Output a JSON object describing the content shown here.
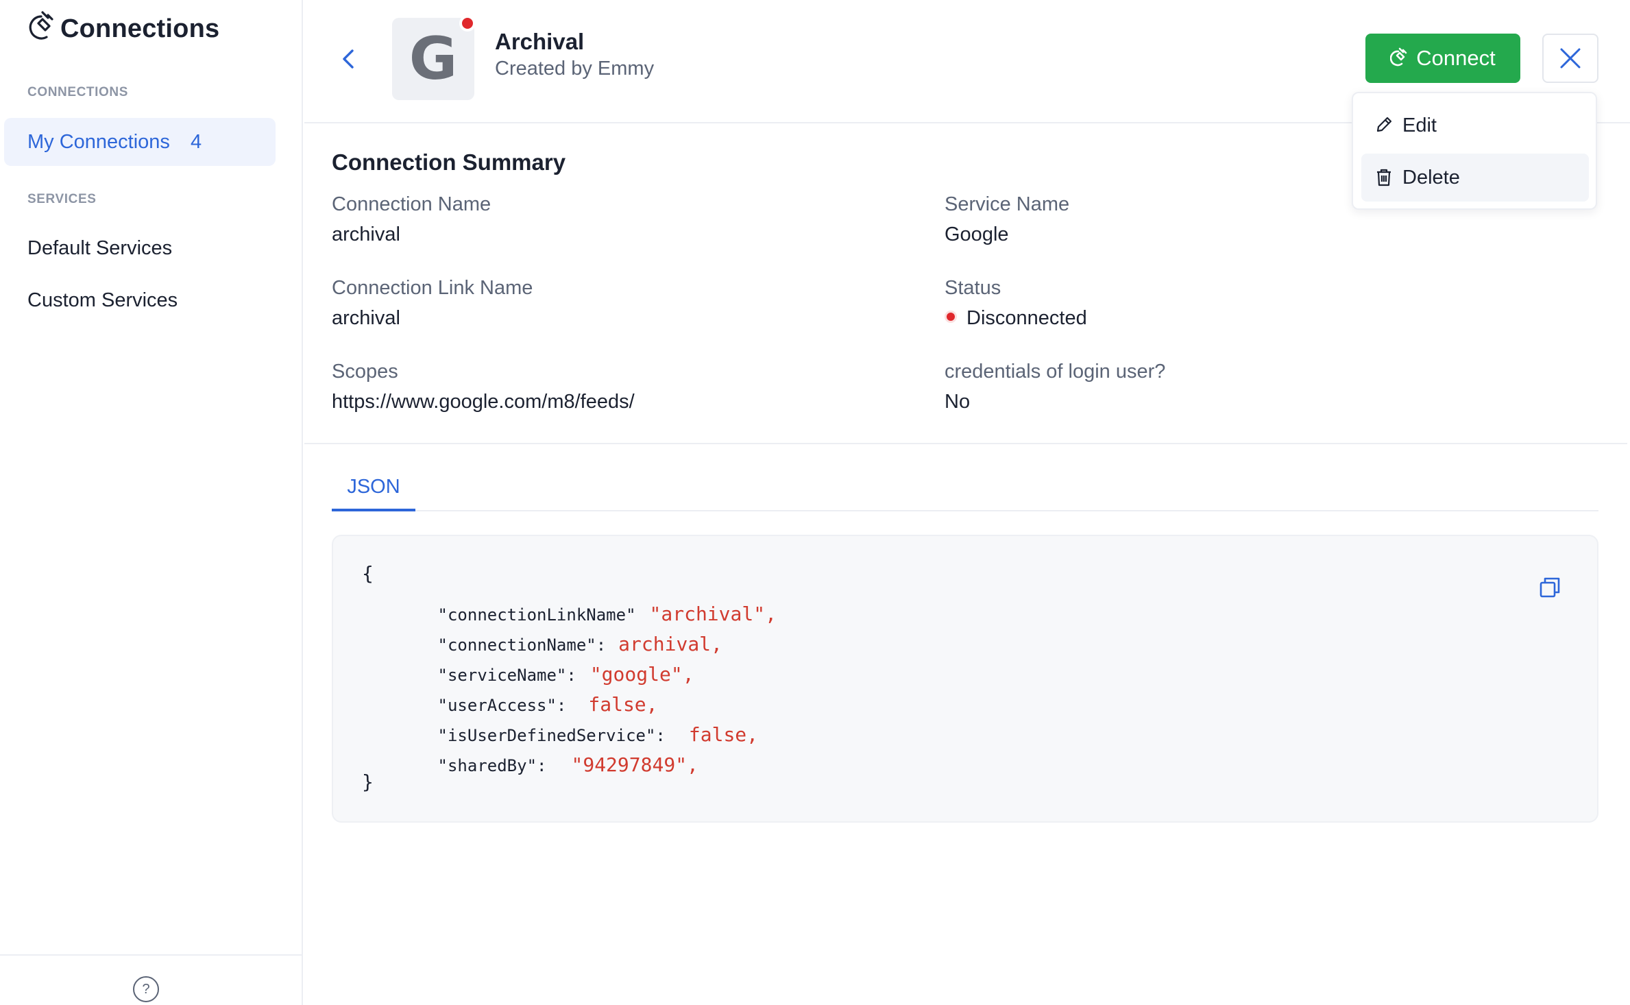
{
  "sidebar": {
    "title": "Connections",
    "section_connections": "CONNECTIONS",
    "my_connections_label": "My Connections",
    "my_connections_count": "4",
    "section_services": "SERVICES",
    "default_services": "Default Services",
    "custom_services": "Custom Services",
    "help": "?"
  },
  "header": {
    "logo_letter": "G",
    "title": "Archival",
    "subtitle": "Created by Emmy",
    "connect_label": "Connect"
  },
  "menu": {
    "edit_label": "Edit",
    "delete_label": "Delete"
  },
  "summary": {
    "title": "Connection Summary",
    "connection_name_label": "Connection Name",
    "connection_name_value": "archival",
    "service_name_label": "Service Name",
    "service_name_value": "Google",
    "link_name_label": "Connection Link Name",
    "link_name_value": "archival",
    "status_label": "Status",
    "status_value": "Disconnected",
    "scopes_label": "Scopes",
    "scopes_value": "https://www.google.com/m8/feeds/",
    "credentials_label": "credentials of login user?",
    "credentials_value": "No"
  },
  "tabs": {
    "json": "JSON"
  },
  "json": {
    "open": "{",
    "close": "}",
    "lines": [
      {
        "key": "\"connectionLinkName\"",
        "value": "\"archival\","
      },
      {
        "key": "\"connectionName\":",
        "value": "archival,"
      },
      {
        "key": "\"serviceName\":",
        "value": "\"google\","
      },
      {
        "key": "\"userAccess\":",
        "value": "false,"
      },
      {
        "key": "\"isUserDefinedService\":",
        "value": "false,"
      },
      {
        "key": "\"sharedBy\":",
        "value": "\"94297849\","
      }
    ]
  },
  "colors": {
    "accent": "#2d66d9",
    "connect": "#24a94d",
    "error": "#e0282c"
  }
}
